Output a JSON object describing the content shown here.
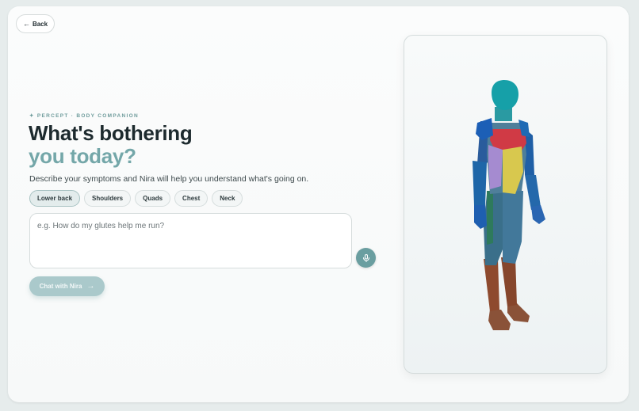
{
  "nav": {
    "back_label": "Back"
  },
  "hero": {
    "eyebrow": "✦ PERCEPT · BODY COMPANION",
    "title_line1": "What's bothering",
    "title_line2": "you today?",
    "subtitle": "Describe your symptoms and Nira will help you understand what's going on."
  },
  "chips": [
    {
      "label": "Lower back",
      "selected": true
    },
    {
      "label": "Shoulders",
      "selected": false
    },
    {
      "label": "Quads",
      "selected": false
    },
    {
      "label": "Chest",
      "selected": false
    },
    {
      "label": "Neck",
      "selected": false
    }
  ],
  "prompt": {
    "placeholder": "e.g. How do my glutes help me run?",
    "value": ""
  },
  "actions": {
    "chat_label": "Chat with Nira"
  },
  "colors": {
    "accent": "#6a9ea0",
    "title_secondary": "#74a7a9",
    "chat_button_disabled": "#aac9cb"
  },
  "icons": {
    "back": "arrow-left-icon",
    "mic": "microphone-icon",
    "chat": "arrow-right-icon"
  },
  "model": {
    "description": "3D body model",
    "regions": [
      "head",
      "shoulders",
      "chest",
      "abdomen",
      "arms",
      "forearms",
      "hands",
      "thighs",
      "shins",
      "feet"
    ]
  }
}
